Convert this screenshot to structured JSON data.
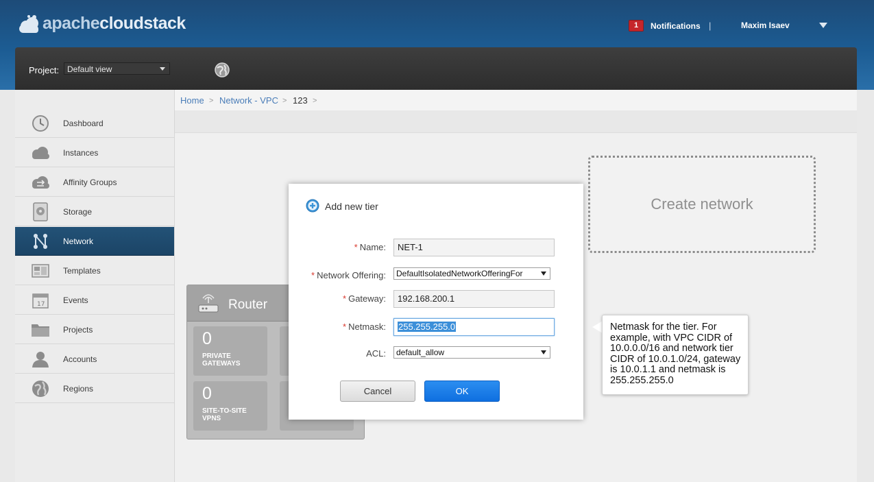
{
  "header": {
    "logo_text_main": "apache",
    "logo_text_brand": "cloudstack",
    "notifications_count": "1",
    "notifications_label": "Notifications",
    "separator": "|",
    "user_name": "Maxim Isaev"
  },
  "project_bar": {
    "label": "Project:",
    "selected": "Default view"
  },
  "sidebar": {
    "items": [
      {
        "label": "Dashboard",
        "icon": "dashboard-icon"
      },
      {
        "label": "Instances",
        "icon": "cloud-icon"
      },
      {
        "label": "Affinity Groups",
        "icon": "affinity-icon"
      },
      {
        "label": "Storage",
        "icon": "storage-icon"
      },
      {
        "label": "Network",
        "icon": "network-icon"
      },
      {
        "label": "Templates",
        "icon": "templates-icon"
      },
      {
        "label": "Events",
        "icon": "calendar-icon"
      },
      {
        "label": "Projects",
        "icon": "folder-icon"
      },
      {
        "label": "Accounts",
        "icon": "user-icon"
      },
      {
        "label": "Regions",
        "icon": "globe-icon"
      }
    ]
  },
  "breadcrumb": {
    "home": "Home",
    "network_vpc": "Network - VPC",
    "current": "123",
    "sep": ">"
  },
  "main": {
    "create_network_label": "Create network",
    "router": {
      "title": "Router",
      "tiles": [
        {
          "num": "0",
          "caption": "PRIVATE GATEWAYS"
        },
        {
          "num": "0",
          "caption": "SITE-TO-SITE VPNS"
        }
      ]
    }
  },
  "dialog": {
    "title": "Add new tier",
    "required_mark": "*",
    "fields": {
      "name_label": "Name:",
      "name_value": "NET-1",
      "offering_label": "Network Offering:",
      "offering_value": "DefaultIsolatedNetworkOfferingFor",
      "gateway_label": "Gateway:",
      "gateway_value": "192.168.200.1",
      "netmask_label": "Netmask:",
      "netmask_value": "255.255.255.0",
      "acl_label": "ACL:",
      "acl_value": "default_allow"
    },
    "cancel_label": "Cancel",
    "ok_label": "OK"
  },
  "tooltip": {
    "text": "Netmask for the tier. For example, with VPC CIDR of 10.0.0.0/16 and network tier CIDR of 10.0.1.0/24, gateway is 10.0.1.1 and netmask is 255.255.255.0"
  },
  "colors": {
    "header_blue": "#1c5c93",
    "active_nav": "#235277",
    "ok_button": "#1a7de8",
    "required": "#d9392e",
    "badge": "#c6262b"
  }
}
